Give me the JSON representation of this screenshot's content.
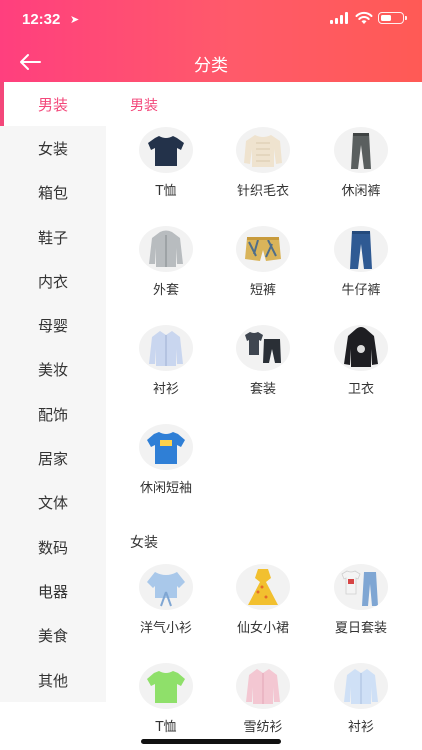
{
  "status_bar": {
    "time": "12:32"
  },
  "header": {
    "title": "分类"
  },
  "colors": {
    "accent": "#f3477a",
    "header_start": "#ff3f7e",
    "header_end": "#ff5a55"
  },
  "sidebar": {
    "items": [
      {
        "label": "男装",
        "active": true
      },
      {
        "label": "女装"
      },
      {
        "label": "箱包"
      },
      {
        "label": "鞋子"
      },
      {
        "label": "内衣"
      },
      {
        "label": "母婴"
      },
      {
        "label": "美妆"
      },
      {
        "label": "配饰"
      },
      {
        "label": "居家"
      },
      {
        "label": "文体"
      },
      {
        "label": "数码"
      },
      {
        "label": "电器"
      },
      {
        "label": "美食"
      },
      {
        "label": "其他"
      }
    ]
  },
  "sections": [
    {
      "title": "男装",
      "items": [
        {
          "label": "T恤",
          "icon": "tshirt-icon"
        },
        {
          "label": "针织毛衣",
          "icon": "sweater-icon"
        },
        {
          "label": "休闲裤",
          "icon": "pants-icon"
        },
        {
          "label": "外套",
          "icon": "jacket-icon"
        },
        {
          "label": "短裤",
          "icon": "shorts-icon"
        },
        {
          "label": "牛仔裤",
          "icon": "jeans-icon"
        },
        {
          "label": "衬衫",
          "icon": "shirt-icon"
        },
        {
          "label": "套装",
          "icon": "suit-set-icon"
        },
        {
          "label": "卫衣",
          "icon": "hoodie-icon"
        },
        {
          "label": "休闲短袖",
          "icon": "casual-tee-icon"
        }
      ]
    },
    {
      "title": "女装",
      "items": [
        {
          "label": "洋气小衫",
          "icon": "blouse-icon"
        },
        {
          "label": "仙女小裙",
          "icon": "dress-icon"
        },
        {
          "label": "夏日套装",
          "icon": "summer-set-icon"
        },
        {
          "label": "T恤",
          "icon": "tshirt-icon"
        },
        {
          "label": "雪纺衫",
          "icon": "chiffon-icon"
        },
        {
          "label": "衬衫",
          "icon": "shirt-icon"
        }
      ]
    }
  ]
}
